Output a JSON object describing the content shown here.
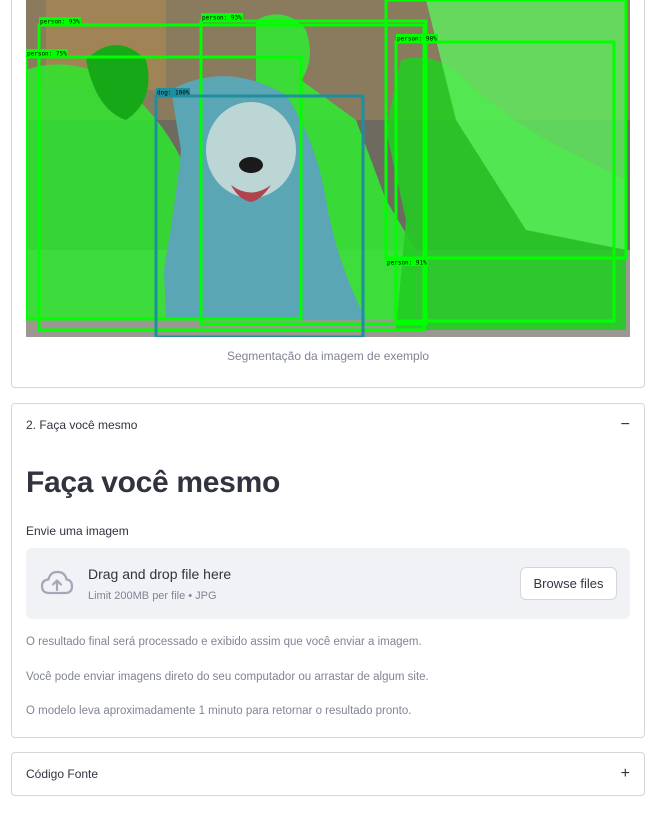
{
  "image_section": {
    "caption": "Segmentação da imagem de exemplo",
    "detections": [
      {
        "label": "person: 93%",
        "color": "#00ff00"
      },
      {
        "label": "person: 75%",
        "color": "#00ff00"
      },
      {
        "label": "person: 93%",
        "color": "#00ff00"
      },
      {
        "label": "dog: 100%",
        "color": "#1f8fa0"
      },
      {
        "label": "person: 98%",
        "color": "#00ff00"
      },
      {
        "label": "person: 91%",
        "color": "#00ff00"
      }
    ]
  },
  "diy_section": {
    "header": "2. Faça você mesmo",
    "toggle": "−",
    "title": "Faça você mesmo",
    "upload_label": "Envie uma imagem",
    "dropzone": {
      "main": "Drag and drop file here",
      "sub": "Limit 200MB per file • JPG",
      "button": "Browse files",
      "icon": "cloud-upload-icon"
    },
    "info": [
      "O resultado final será processado e exibido assim que você enviar a imagem.",
      "Você pode enviar imagens direto do seu computador ou arrastar de algum site.",
      "O modelo leva aproximadamente 1 minuto para retornar o resultado pronto."
    ]
  },
  "code_section": {
    "header": "Código Fonte",
    "toggle": "+"
  }
}
